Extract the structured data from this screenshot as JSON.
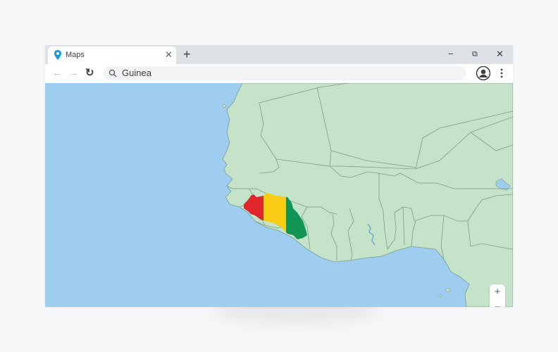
{
  "browser": {
    "tab": {
      "title": "Maps",
      "close_glyph": "✕",
      "icon": "map-pin-icon"
    },
    "new_tab_glyph": "+",
    "window_controls": {
      "minimize": "−",
      "restore": "⧉",
      "close": "✕"
    },
    "nav": {
      "back": "←",
      "forward": "→",
      "reload": "↻"
    },
    "search": {
      "query": "Guinea",
      "icon": "search-icon"
    },
    "menu_icon": "kebab-menu-icon",
    "profile_icon": "account-icon"
  },
  "map": {
    "highlighted_country": "Guinea",
    "zoom_in": "+",
    "zoom_out": "−",
    "colors": {
      "water": "#9ecdf0",
      "land": "#c4e3c8",
      "border": "#7f9c86",
      "flag_red": "#e0262b",
      "flag_yellow": "#f9cd15",
      "flag_green": "#149454"
    }
  },
  "colors": {
    "tab_bar": "#dee1e6",
    "omnibox": "#f1f3f4",
    "pin": "#1a9bd7"
  }
}
